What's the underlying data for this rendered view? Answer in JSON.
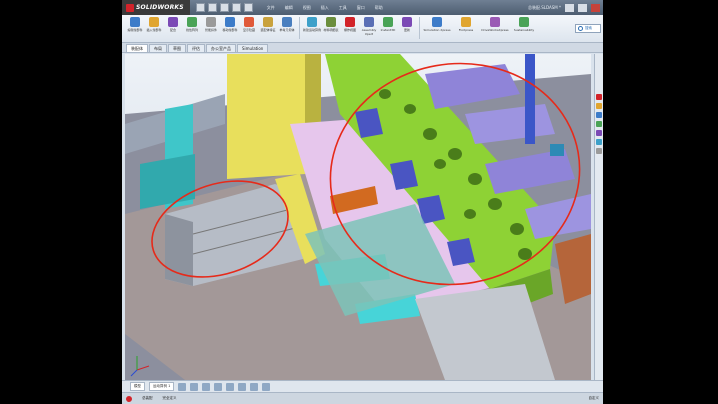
{
  "app": {
    "logo_text": "SOLIDWORKS",
    "menus": [
      "文件",
      "编辑",
      "视图",
      "插入",
      "工具",
      "窗口",
      "帮助"
    ],
    "window_title": "总装配.SLDASM *",
    "colors": {
      "brand": "#d2232a",
      "titlebar": "#4d5d70",
      "ribbon": "#e8eef5"
    }
  },
  "ribbon": {
    "buttons": [
      {
        "label": "编辑零部件",
        "icon": "edit-component-icon",
        "color": "#3d7cc9"
      },
      {
        "label": "插入零部件",
        "icon": "insert-component-icon",
        "color": "#e0a530"
      },
      {
        "label": "配合",
        "icon": "mate-icon",
        "color": "#7b4ab5"
      },
      {
        "label": "线性阵列",
        "icon": "linear-pattern-icon",
        "color": "#4aa357"
      },
      {
        "label": "智能扣件",
        "icon": "smart-fastener-icon",
        "color": "#9a9a9a"
      },
      {
        "label": "移动零部件",
        "icon": "move-component-icon",
        "color": "#3d7cc9"
      },
      {
        "label": "显示隐藏",
        "icon": "show-hide-icon",
        "color": "#e05a3a"
      },
      {
        "label": "装配体特征",
        "icon": "assembly-feature-icon",
        "color": "#c9a23d"
      },
      {
        "label": "参考几何体",
        "icon": "reference-geometry-icon",
        "color": "#4a7fbf"
      },
      {
        "label": "新建运动算例",
        "icon": "motion-study-icon",
        "color": "#3da0c9"
      },
      {
        "label": "材料明细表",
        "icon": "bill-of-materials-icon",
        "color": "#6b8e3d"
      },
      {
        "label": "爆炸视图",
        "icon": "exploded-view-icon",
        "color": "#d2232a"
      },
      {
        "label": "Assembly Xpert",
        "icon": "assembly-xpert-icon",
        "color": "#5a6fb5"
      },
      {
        "label": "Instant3D",
        "icon": "instant3d-icon",
        "color": "#4aa357"
      },
      {
        "label": "更新",
        "icon": "update-icon",
        "color": "#7b4ab5"
      },
      {
        "label": "Simulation Xpress",
        "icon": "simulation-icon",
        "color": "#3d7cc9"
      },
      {
        "label": "FloXpress",
        "icon": "floxpress-icon",
        "color": "#e0a530"
      },
      {
        "label": "DriveWorksXpress",
        "icon": "driveworks-icon",
        "color": "#9a5ab5"
      },
      {
        "label": "Sustainability",
        "icon": "sustainability-icon",
        "color": "#4aa357"
      }
    ],
    "search_label": "搜索"
  },
  "tabs": [
    "装配体",
    "布局",
    "草图",
    "评估",
    "办公室产品",
    "Simulation"
  ],
  "active_tab": 0,
  "view_tabs": [
    "模型",
    "运动算例 1"
  ],
  "status": {
    "left": "总装配",
    "middle": "完全定义",
    "right": "自定义"
  }
}
